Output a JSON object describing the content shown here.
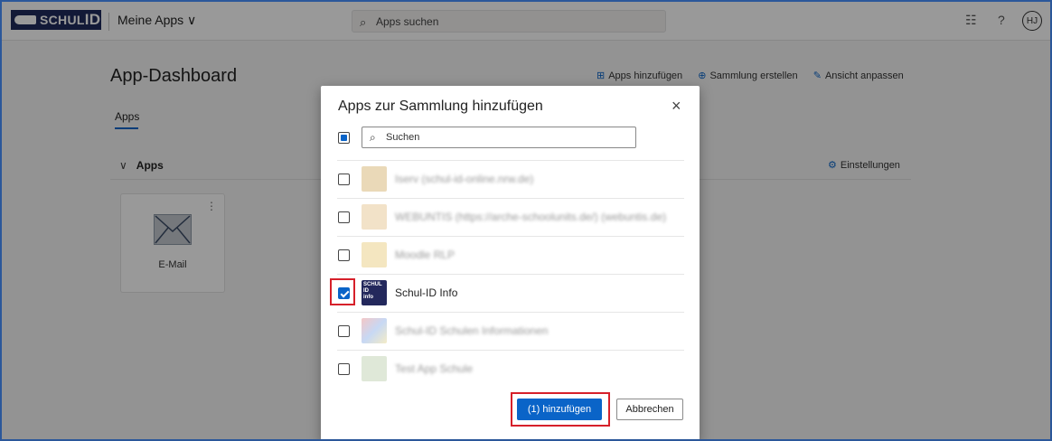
{
  "topbar": {
    "logo_text": "SCHUL",
    "logo_id": "ID",
    "my_apps": "Meine Apps ∨",
    "search_placeholder": "Apps suchen",
    "help": "?",
    "user_initials": "HJ"
  },
  "dashboard": {
    "title": "App-Dashboard",
    "actions": [
      "Apps hinzufügen",
      "Sammlung erstellen",
      "Ansicht anpassen"
    ],
    "tab": "Apps",
    "section": "Apps",
    "settings": "Einstellungen",
    "tile_label": "E-Mail"
  },
  "dialog": {
    "title": "Apps zur Sammlung hinzufügen",
    "close": "×",
    "search_placeholder": "Suchen",
    "apps": [
      {
        "name": "Iserv (schul-id-online.nrw.de)",
        "checked": false,
        "blurred": true
      },
      {
        "name": "WEBUNTIS (https://arche-schoolunits.de/) (webuntis.de)",
        "checked": false,
        "blurred": true
      },
      {
        "name": "Moodle RLP",
        "checked": false,
        "blurred": true
      },
      {
        "name": "Schul-ID Info",
        "checked": true,
        "blurred": false
      },
      {
        "name": "Schul-ID Schulen Informationen",
        "checked": false,
        "blurred": true
      },
      {
        "name": "Test App Schule",
        "checked": false,
        "blurred": true
      }
    ],
    "add_button": "(1) hinzufügen",
    "cancel_button": "Abbrechen"
  },
  "colors": {
    "accent": "#0a64c8",
    "highlight": "#d6202a",
    "brand": "#1f2a5c"
  }
}
